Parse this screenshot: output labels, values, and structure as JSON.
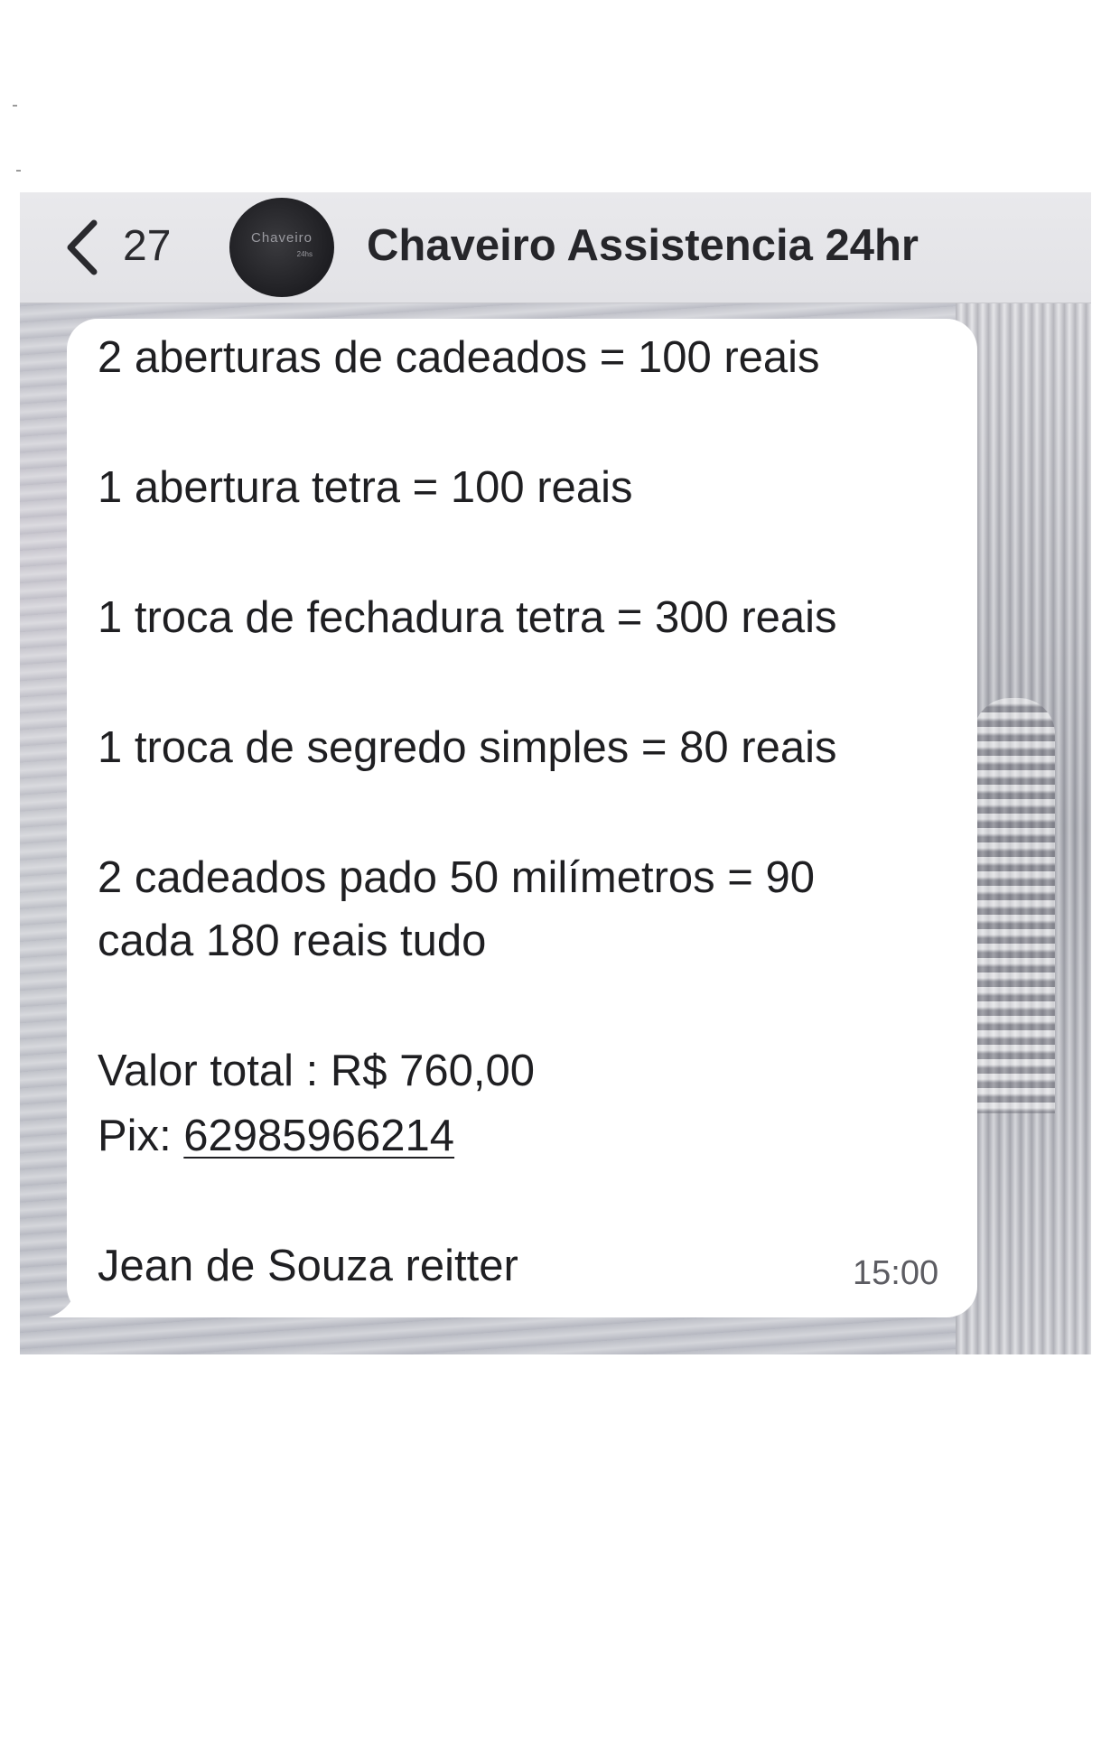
{
  "header": {
    "back_count": "27",
    "avatar_text": "Chaveiro",
    "avatar_subtext": "24hs",
    "contact_name": "Chaveiro Assistencia 24hr"
  },
  "message": {
    "lines": [
      "2 aberturas de cadeados = 100 reais",
      "1 abertura tetra = 100 reais",
      "1 troca de fechadura tetra = 300 reais",
      "1 troca de segredo simples = 80 reais",
      "2 cadeados pado 50 milímetros = 90",
      "cada 180 reais tudo",
      "Valor total : R$ 760,00"
    ],
    "pix_label": "Pix: ",
    "pix_number": "62985966214",
    "signature": "Jean de Souza reitter",
    "time": "15:00"
  },
  "icons": {
    "back": "chevron-left-icon"
  },
  "colors": {
    "header_bg": "#e6e6e9",
    "bubble_bg": "#ffffff",
    "text": "#1f1f22",
    "wallpaper": "#c4c6cc"
  }
}
